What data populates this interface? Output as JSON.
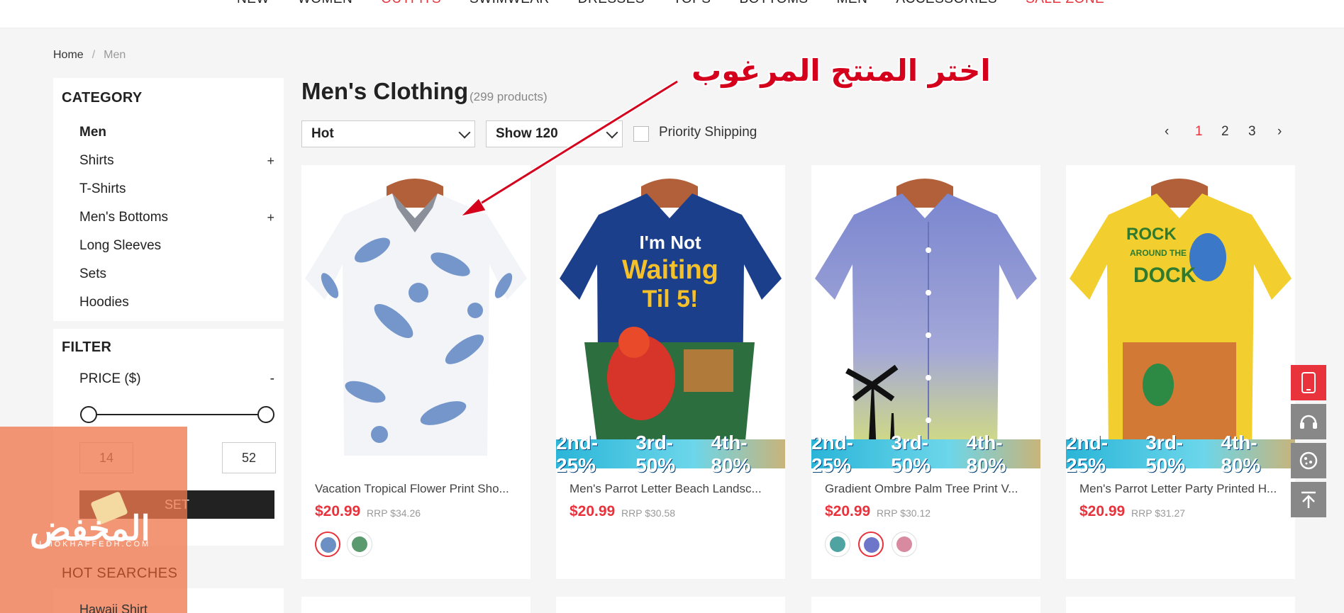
{
  "topnav": {
    "items": [
      "NEW",
      "WOMEN",
      "OUTFITS",
      "SWIMWEAR",
      "DRESSES",
      "TOPS",
      "BOTTOMS",
      "MEN",
      "ACCESSORIES",
      "SALE ZONE"
    ]
  },
  "breadcrumb": {
    "home": "Home",
    "sep": "/",
    "current": "Men"
  },
  "category": {
    "title": "CATEGORY",
    "items": [
      {
        "label": "Men",
        "plus": ""
      },
      {
        "label": "Shirts",
        "plus": "+"
      },
      {
        "label": "T-Shirts",
        "plus": ""
      },
      {
        "label": "Men's Bottoms",
        "plus": "+"
      },
      {
        "label": "Long Sleeves",
        "plus": ""
      },
      {
        "label": "Sets",
        "plus": ""
      },
      {
        "label": "Hoodies",
        "plus": ""
      }
    ]
  },
  "filter": {
    "title": "FILTER",
    "price_label": "PRICE ($)",
    "collapse": "-",
    "min": "14",
    "max": "52",
    "set": "SET"
  },
  "hot": {
    "title": "HOT SEARCHES",
    "first": "Hawaii Shirt"
  },
  "watermark": {
    "text": "المخفض",
    "sub": "ALMOKHAFFEDH.COM"
  },
  "main": {
    "title": "Men's Clothing",
    "count": "(299 products)",
    "sort": "Hot",
    "show": "Show 120",
    "priority": "Priority Shipping",
    "pages": [
      "‹",
      "1",
      "2",
      "3",
      "›"
    ]
  },
  "annotation": "اختر المنتج المرغوب",
  "banner": [
    "2nd-25%",
    "3rd-50%",
    "4th-80%"
  ],
  "products": [
    {
      "title": "Vacation Tropical Flower Print Sho...",
      "price": "$20.99",
      "rrp": "RRP $34.26"
    },
    {
      "title": "Men's Parrot Letter Beach Landsc...",
      "price": "$20.99",
      "rrp": "RRP $30.58",
      "art": [
        "I'm Not",
        "Waiting",
        "Til 5!"
      ]
    },
    {
      "title": "Gradient Ombre Palm Tree Print V...",
      "price": "$20.99",
      "rrp": "RRP $30.12"
    },
    {
      "title": "Men's Parrot Letter Party Printed H...",
      "price": "$20.99",
      "rrp": "RRP $31.27",
      "art": [
        "ROCK",
        "AROUND THE",
        "DOCK"
      ]
    }
  ],
  "colors": {
    "accent": "#e8323c",
    "watermark": "#ef7850"
  }
}
